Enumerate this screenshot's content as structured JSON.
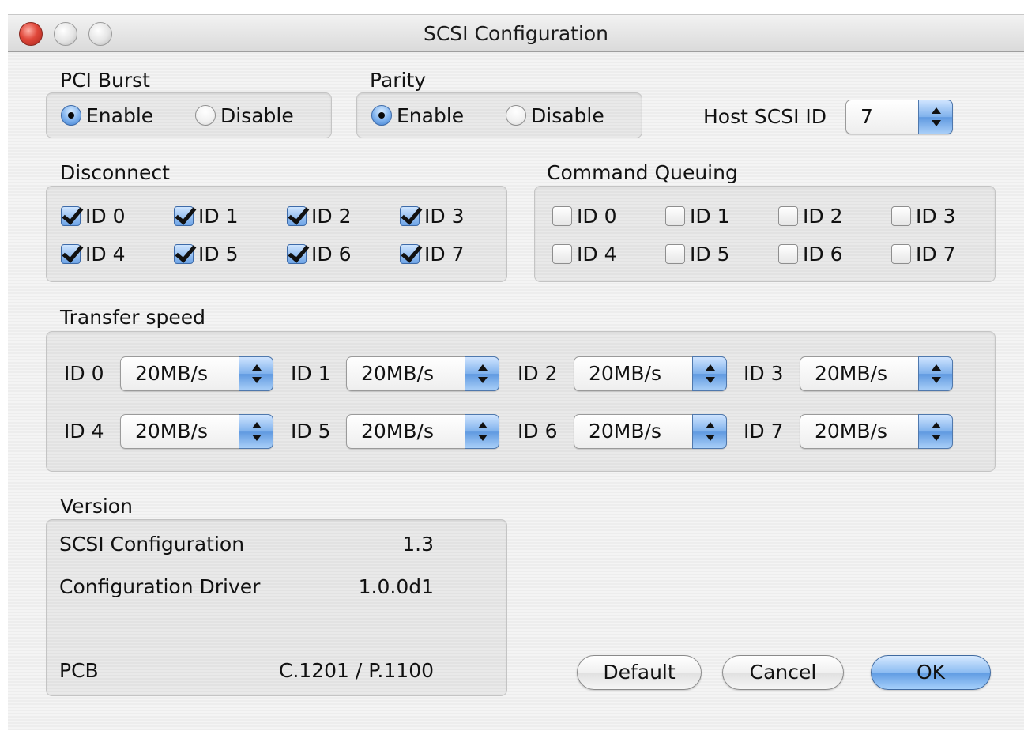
{
  "window": {
    "title": "SCSI Configuration"
  },
  "pci_burst": {
    "label": "PCI Burst",
    "enable": "Enable",
    "disable": "Disable",
    "selected": "Enable"
  },
  "parity": {
    "label": "Parity",
    "enable": "Enable",
    "disable": "Disable",
    "selected": "Enable"
  },
  "host_scsi_id": {
    "label": "Host SCSI ID",
    "value": "7"
  },
  "disconnect": {
    "label": "Disconnect",
    "items": [
      {
        "label": "ID 0",
        "checked": true
      },
      {
        "label": "ID 1",
        "checked": true
      },
      {
        "label": "ID 2",
        "checked": true
      },
      {
        "label": "ID 3",
        "checked": true
      },
      {
        "label": "ID 4",
        "checked": true
      },
      {
        "label": "ID 5",
        "checked": true
      },
      {
        "label": "ID 6",
        "checked": true
      },
      {
        "label": "ID 7",
        "checked": true
      }
    ]
  },
  "command_queuing": {
    "label": "Command Queuing",
    "items": [
      {
        "label": "ID 0",
        "checked": false
      },
      {
        "label": "ID 1",
        "checked": false
      },
      {
        "label": "ID 2",
        "checked": false
      },
      {
        "label": "ID 3",
        "checked": false
      },
      {
        "label": "ID 4",
        "checked": false
      },
      {
        "label": "ID 5",
        "checked": false
      },
      {
        "label": "ID 6",
        "checked": false
      },
      {
        "label": "ID 7",
        "checked": false
      }
    ]
  },
  "transfer_speed": {
    "label": "Transfer speed",
    "items": [
      {
        "label": "ID 0",
        "value": "20MB/s"
      },
      {
        "label": "ID 1",
        "value": "20MB/s"
      },
      {
        "label": "ID 2",
        "value": "20MB/s"
      },
      {
        "label": "ID 3",
        "value": "20MB/s"
      },
      {
        "label": "ID 4",
        "value": "20MB/s"
      },
      {
        "label": "ID 5",
        "value": "20MB/s"
      },
      {
        "label": "ID 6",
        "value": "20MB/s"
      },
      {
        "label": "ID 7",
        "value": "20MB/s"
      }
    ]
  },
  "version": {
    "label": "Version",
    "rows": [
      {
        "name": "SCSI Configuration",
        "value": "1.3"
      },
      {
        "name": "Configuration Driver",
        "value": "1.0.0d1"
      },
      {
        "name": "PCB",
        "value": "C.1201 / P.1100"
      }
    ]
  },
  "buttons": {
    "default": "Default",
    "cancel": "Cancel",
    "ok": "OK"
  },
  "colors": {
    "accent": "#6fa6ea",
    "close_button": "#e0473a"
  }
}
